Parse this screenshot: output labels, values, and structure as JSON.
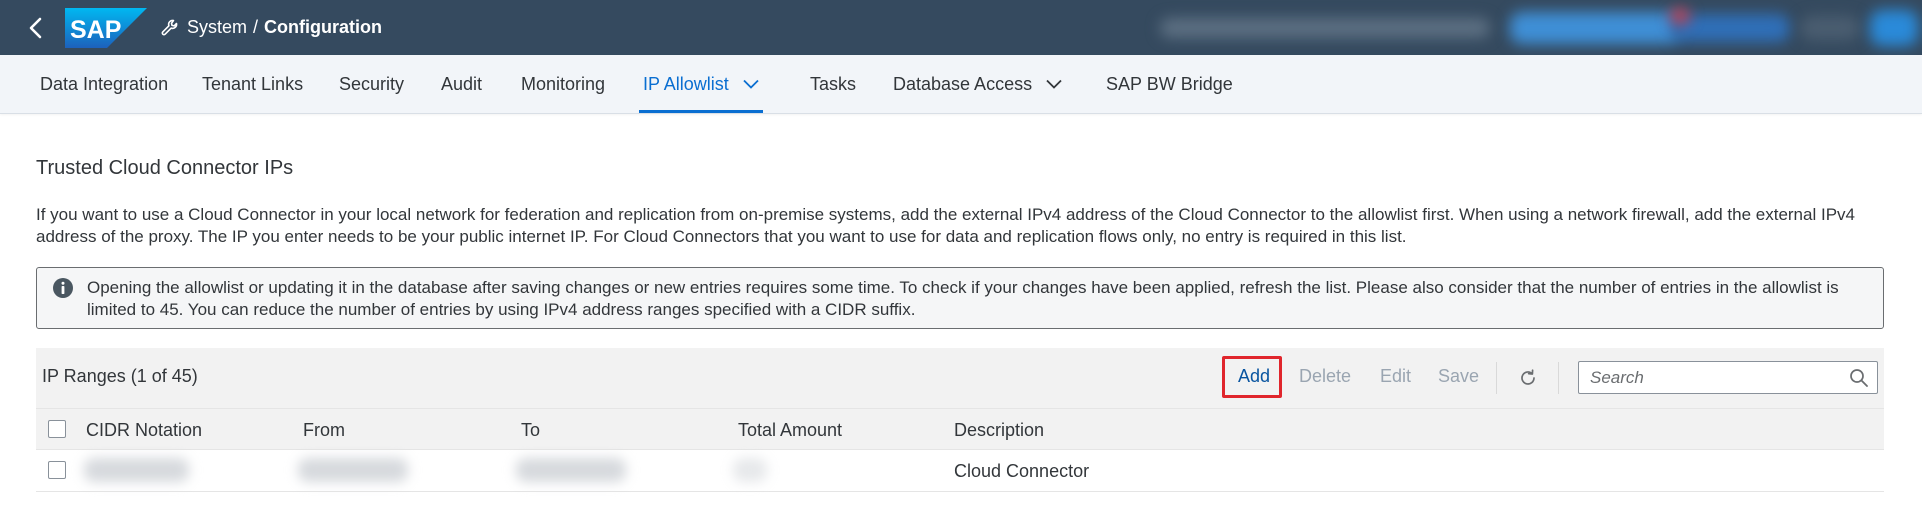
{
  "shell": {
    "logo_text": "SAP",
    "breadcrumb_parent": "System",
    "breadcrumb_separator": "/",
    "breadcrumb_current": "Configuration"
  },
  "tabs": [
    {
      "label": "Data Integration"
    },
    {
      "label": "Tenant Links"
    },
    {
      "label": "Security"
    },
    {
      "label": "Audit"
    },
    {
      "label": "Monitoring"
    },
    {
      "label": "IP Allowlist",
      "active": true,
      "has_dropdown": true
    },
    {
      "label": "Tasks"
    },
    {
      "label": "Database Access",
      "has_dropdown": true
    },
    {
      "label": "SAP BW Bridge"
    }
  ],
  "section": {
    "title": "Trusted Cloud Connector IPs",
    "description": "If you want to use a Cloud Connector in your local network for federation and replication from on-premise systems, add the external IPv4 address of the Cloud Connector to the allowlist first. When using a network firewall, add the external IPv4 address of the proxy. The IP you enter needs to be your public internet IP. For Cloud Connectors that you want to use for data and replication flows only, no entry is required in this list.",
    "info_message": "Opening the allowlist or updating it in the database after saving changes or new entries requires some time. To check if your changes have been applied, refresh the list. Please also consider that the number of entries in the allowlist is limited to 45. You can reduce the number of entries by using IPv4 address ranges specified with a CIDR suffix."
  },
  "table": {
    "title": "IP Ranges (1 of 45)",
    "buttons": {
      "add": "Add",
      "delete": "Delete",
      "edit": "Edit",
      "save": "Save"
    },
    "search_placeholder": "Search",
    "columns": [
      "CIDR Notation",
      "From",
      "To",
      "Total Amount",
      "Description"
    ],
    "rows": [
      {
        "cidr": "",
        "from": "",
        "to": "",
        "total": "",
        "description": "Cloud Connector"
      }
    ]
  },
  "colors": {
    "shell_bg": "#354a5f",
    "accent": "#0a6ed1",
    "highlight_border": "#e0262c"
  }
}
